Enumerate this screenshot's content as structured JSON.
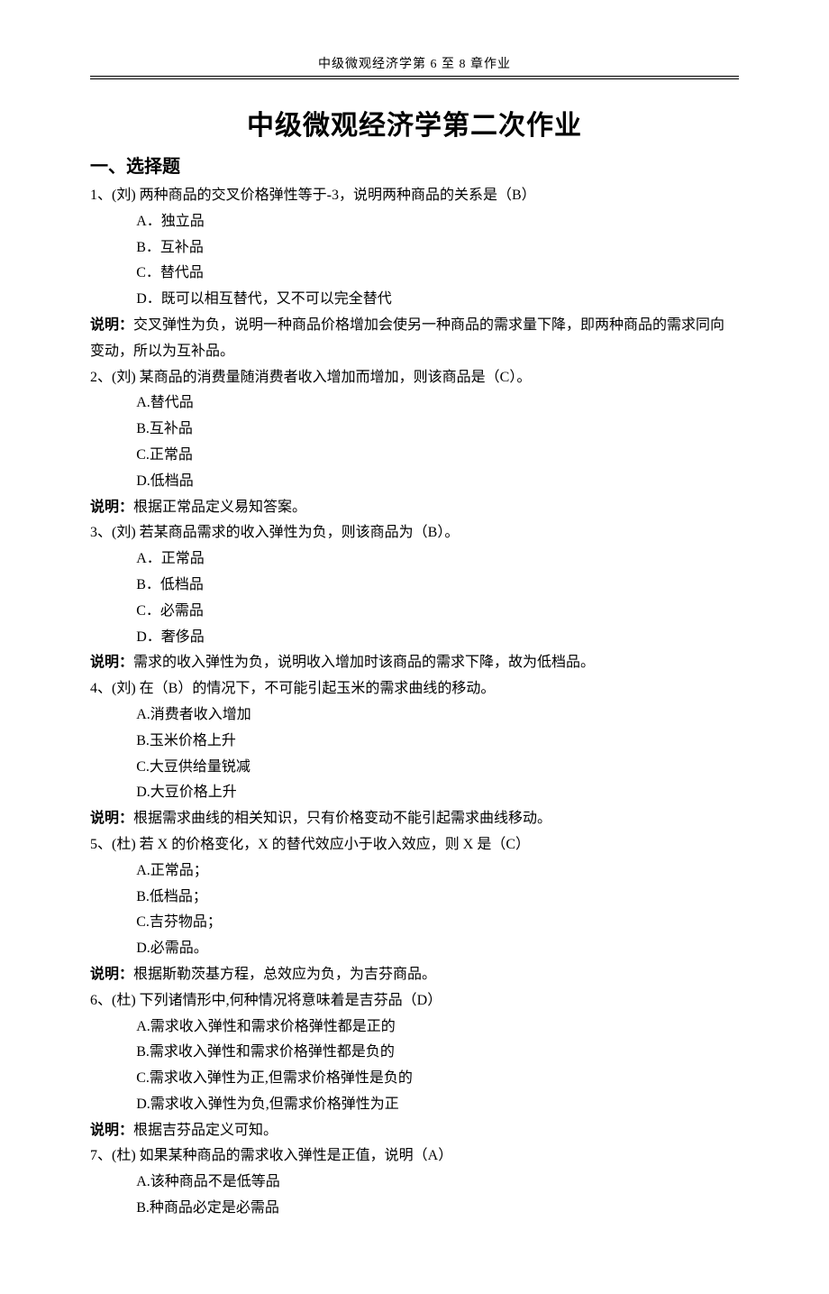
{
  "running_head": "中级微观经济学第 6 至 8 章作业",
  "title": "中级微观经济学第二次作业",
  "section1_heading": "一、选择题",
  "questions": [
    {
      "stem": "1、(刘) 两种商品的交叉价格弹性等于-3，说明两种商品的关系是（B）",
      "options": [
        "A．独立品",
        "B．互补品",
        "C．替代品",
        "D．既可以相互替代，又不可以完全替代"
      ],
      "explain_label": "说明：",
      "explain": "交叉弹性为负，说明一种商品价格增加会使另一种商品的需求量下降，即两种商品的需求同向变动，所以为互补品。"
    },
    {
      "stem": "2、(刘) 某商品的消费量随消费者收入增加而增加，则该商品是（C）。",
      "options": [
        "A.替代品",
        "B.互补品",
        "C.正常品",
        "D.低档品"
      ],
      "explain_label": "说明：",
      "explain": "根据正常品定义易知答案。"
    },
    {
      "stem": "3、(刘) 若某商品需求的收入弹性为负，则该商品为（B）。",
      "options": [
        "A．正常品",
        "B．低档品",
        "C．必需品",
        "D．奢侈品"
      ],
      "explain_label": "说明：",
      "explain": "需求的收入弹性为负，说明收入增加时该商品的需求下降，故为低档品。"
    },
    {
      "stem": "4、(刘) 在（B）的情况下，不可能引起玉米的需求曲线的移动。",
      "options": [
        "A.消费者收入增加",
        "B.玉米价格上升",
        "C.大豆供给量锐减",
        "D.大豆价格上升"
      ],
      "explain_label": "说明：",
      "explain": "根据需求曲线的相关知识，只有价格变动不能引起需求曲线移动。"
    },
    {
      "stem": "5、(杜) 若 X 的价格变化，X 的替代效应小于收入效应，则 X 是（C）",
      "options": [
        "A.正常品；",
        "B.低档品；",
        "C.吉芬物品；",
        "D.必需品。"
      ],
      "explain_label": "说明：",
      "explain": "根据斯勒茨基方程，总效应为负，为吉芬商品。"
    },
    {
      "stem": "6、(杜) 下列诸情形中,何种情况将意味着是吉芬品（D）",
      "options": [
        "A.需求收入弹性和需求价格弹性都是正的",
        "B.需求收入弹性和需求价格弹性都是负的",
        "C.需求收入弹性为正,但需求价格弹性是负的",
        "D.需求收入弹性为负,但需求价格弹性为正"
      ],
      "explain_label": "说明：",
      "explain": "根据吉芬品定义可知。"
    },
    {
      "stem": "7、(杜) 如果某种商品的需求收入弹性是正值，说明（A）",
      "options": [
        "A.该种商品不是低等品",
        "B.种商品必定是必需品"
      ],
      "explain_label": "",
      "explain": ""
    }
  ]
}
